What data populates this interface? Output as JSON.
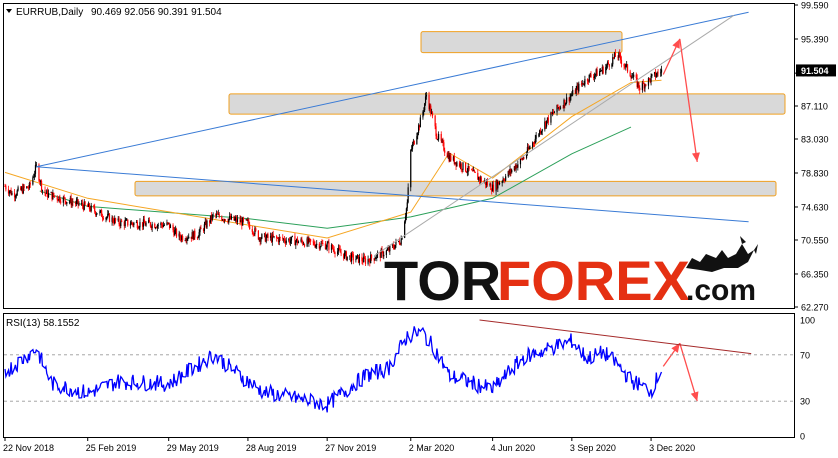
{
  "header": {
    "symbol_label": "EURRUB,Daily",
    "ohlc_label": "90.469 92.056 90.391 91.504"
  },
  "rsi_panel": {
    "label": "RSI(13) 58.1552"
  },
  "watermark": {
    "text_a": "TOR",
    "text_b": "FOREX",
    "text_c": ".com"
  },
  "colors": {
    "candle_up": "#000000",
    "candle_down": "#ff0000",
    "ma_fast": "#f5a623",
    "ma_slow": "#2ca05a",
    "ma_long": "#aaaaaa",
    "trendline": "#3a7bd5",
    "zone_fill": "#d9d9d9",
    "zone_border": "#f0a020",
    "arrow": "#ff4d4d",
    "rsi_line": "#0000ff",
    "rsi_trend": "#a52a2a",
    "watermark_dark": "#111111",
    "watermark_red": "#e53012"
  },
  "chart_data": [
    {
      "type": "candlestick",
      "title": "EURRUB,Daily",
      "current_price": 91.504,
      "ylim": [
        62.27,
        99.59
      ],
      "y_ticks": [
        "99.590",
        "95.390",
        "91.170",
        "87.110",
        "83.030",
        "78.830",
        "74.630",
        "70.550",
        "66.350",
        "62.270"
      ],
      "x_ticks": [
        "22 Nov 2018",
        "25 Feb 2019",
        "29 May 2019",
        "28 Aug 2019",
        "27 Nov 2019",
        "2 Mar 2020",
        "4 Jun 2020",
        "3 Sep 2020",
        "3 Dec 2020"
      ],
      "close_path": [
        [
          "22 Nov 2018",
          77.2
        ],
        [
          "01 Dec 2018",
          76.2
        ],
        [
          "12 Dec 2018",
          76.8
        ],
        [
          "20 Dec 2018",
          77.1
        ],
        [
          "28 Dec 2018",
          79.6
        ],
        [
          "05 Jan 2019",
          76.4
        ],
        [
          "25 Jan 2019",
          75.7
        ],
        [
          "25 Feb 2019",
          74.6
        ],
        [
          "01 Apr 2019",
          72.7
        ],
        [
          "29 May 2019",
          72.4
        ],
        [
          "10 Jun 2019",
          70.9
        ],
        [
          "01 Jul 2019",
          71.2
        ],
        [
          "20 Jul 2019",
          73.6
        ],
        [
          "28 Aug 2019",
          72.6
        ],
        [
          "10 Sep 2019",
          70.9
        ],
        [
          "10 Oct 2019",
          70.6
        ],
        [
          "27 Nov 2019",
          69.9
        ],
        [
          "20 Dec 2019",
          68.5
        ],
        [
          "10 Jan 2020",
          68.0
        ],
        [
          "05 Feb 2020",
          69.2
        ],
        [
          "20 Feb 2020",
          70.6
        ],
        [
          "27 Feb 2020",
          75.1
        ],
        [
          "02 Mar 2020",
          81.5
        ],
        [
          "15 Mar 2020",
          85.9
        ],
        [
          "20 Mar 2020",
          88.5
        ],
        [
          "01 Apr 2020",
          83.5
        ],
        [
          "15 Apr 2020",
          80.8
        ],
        [
          "01 May 2020",
          79.6
        ],
        [
          "04 Jun 2020",
          77.0
        ],
        [
          "20 Jun 2020",
          78.5
        ],
        [
          "10 Jul 2020",
          80.8
        ],
        [
          "01 Aug 2020",
          84.7
        ],
        [
          "15 Aug 2020",
          86.5
        ],
        [
          "03 Sep 2020",
          88.5
        ],
        [
          "20 Sep 2020",
          90.5
        ],
        [
          "10 Oct 2020",
          91.7
        ],
        [
          "25 Oct 2020",
          93.5
        ],
        [
          "10 Nov 2020",
          91.0
        ],
        [
          "20 Nov 2020",
          89.4
        ],
        [
          "03 Dec 2020",
          90.5
        ],
        [
          "15 Dec 2020",
          91.5
        ]
      ],
      "moving_average_fast_path": [
        [
          "22 Nov 2018",
          78.9
        ],
        [
          "25 Feb 2019",
          75.7
        ],
        [
          "28 Aug 2019",
          72.4
        ],
        [
          "27 Nov 2019",
          70.8
        ],
        [
          "02 Mar 2020",
          74.0
        ],
        [
          "15 Apr 2020",
          81.3
        ],
        [
          "04 Jun 2020",
          78.2
        ],
        [
          "03 Sep 2020",
          85.8
        ],
        [
          "10 Nov 2020",
          90.0
        ],
        [
          "15 Dec 2020",
          90.3
        ]
      ],
      "moving_average_slow_path": [
        [
          "01 Jan 2019",
          76.6
        ],
        [
          "25 Feb 2019",
          74.7
        ],
        [
          "28 Aug 2019",
          73.2
        ],
        [
          "27 Nov 2019",
          72.0
        ],
        [
          "02 Mar 2020",
          73.4
        ],
        [
          "04 Jun 2020",
          75.7
        ],
        [
          "03 Sep 2020",
          81.2
        ],
        [
          "10 Nov 2020",
          84.5
        ]
      ],
      "support_resistance_zones": [
        {
          "y_low": 93.7,
          "y_high": 96.3
        },
        {
          "y_low": 86.1,
          "y_high": 88.6
        },
        {
          "y_low": 76.0,
          "y_high": 77.8
        }
      ],
      "trendlines": [
        {
          "from": [
            "28 Dec 2018",
            79.6
          ],
          "to": [
            "25 Mar 2021",
            98.7
          ]
        },
        {
          "from": [
            "28 Dec 2018",
            79.6
          ],
          "to": [
            "25 Mar 2021",
            72.8
          ]
        },
        {
          "from": [
            "20 Jan 2020",
            68.6
          ],
          "to": [
            "08 Mar 2021",
            98.3
          ]
        }
      ],
      "forecast_arrows": [
        {
          "from": [
            "17 Dec 2020",
            91.0
          ],
          "to": [
            "05 Jan 2021",
            95.4
          ]
        },
        {
          "from": [
            "05 Jan 2021",
            95.4
          ],
          "to": [
            "25 Jan 2021",
            80.2
          ]
        }
      ]
    },
    {
      "type": "line",
      "title": "RSI(13) 58.1552",
      "current_value": 58.1552,
      "ylim": [
        0,
        100
      ],
      "y_ticks": [
        "100",
        "70",
        "30",
        "0"
      ],
      "levels": [
        70,
        30
      ],
      "rsi_path": [
        [
          "22 Nov 2018",
          55
        ],
        [
          "10 Dec 2018",
          65
        ],
        [
          "28 Dec 2018",
          75
        ],
        [
          "15 Jan 2019",
          45
        ],
        [
          "25 Feb 2019",
          37
        ],
        [
          "01 Apr 2019",
          47
        ],
        [
          "29 May 2019",
          45
        ],
        [
          "20 Jul 2019",
          70
        ],
        [
          "28 Aug 2019",
          47
        ],
        [
          "15 Sep 2019",
          38
        ],
        [
          "27 Nov 2019",
          27
        ],
        [
          "10 Jan 2020",
          52
        ],
        [
          "05 Feb 2020",
          58
        ],
        [
          "27 Feb 2020",
          86
        ],
        [
          "15 Mar 2020",
          90
        ],
        [
          "01 Apr 2020",
          72
        ],
        [
          "15 Apr 2020",
          52
        ],
        [
          "04 Jun 2020",
          40
        ],
        [
          "20 Jun 2020",
          53
        ],
        [
          "10 Jul 2020",
          68
        ],
        [
          "03 Sep 2020",
          82
        ],
        [
          "20 Sep 2020",
          67
        ],
        [
          "10 Oct 2020",
          72
        ],
        [
          "25 Oct 2020",
          62
        ],
        [
          "10 Nov 2020",
          48
        ],
        [
          "03 Dec 2020",
          39
        ],
        [
          "15 Dec 2020",
          58
        ]
      ],
      "rsi_trendline": {
        "from": [
          "20 May 2020",
          100
        ],
        "to": [
          "28 Mar 2021",
          71
        ]
      },
      "forecast_arrows": [
        {
          "from": [
            "17 Dec 2020",
            60
          ],
          "to": [
            "05 Jan 2021",
            80
          ]
        },
        {
          "from": [
            "05 Jan 2021",
            80
          ],
          "to": [
            "25 Jan 2021",
            30
          ]
        }
      ]
    }
  ]
}
